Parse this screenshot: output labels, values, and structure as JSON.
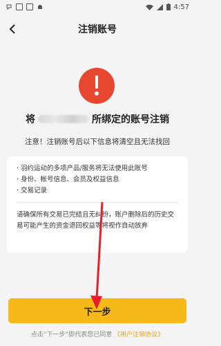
{
  "status_bar": {
    "time": "4:57"
  },
  "header": {
    "title": "注销账号"
  },
  "heading": {
    "prefix": "将",
    "suffix": "所绑定的账号注销"
  },
  "notice": "注意！注销账号后以下信息将清空且无法找回",
  "info_items": [
    "· 羽约运动的多项产品/服务将无法使用此账号",
    "· 身份、帐号信息、会员及权益信息",
    "· 交易记录"
  ],
  "warning": "请确保所有交易已完结且无纠纷，账户删除后的历史交易可能产生的资金退回权益等将视作自动放弃",
  "next_button": {
    "label": "下一步"
  },
  "footer": {
    "prefix": "点击“下一步”即代表您已同意",
    "link": "《用户注销协议》"
  },
  "colors": {
    "accent": "#f6b91a",
    "alert": "#e8472f",
    "arrow": "#e5202a"
  },
  "icons": [
    "back-arrow-icon",
    "alert-icon",
    "wifi-icon",
    "battery-icon"
  ]
}
